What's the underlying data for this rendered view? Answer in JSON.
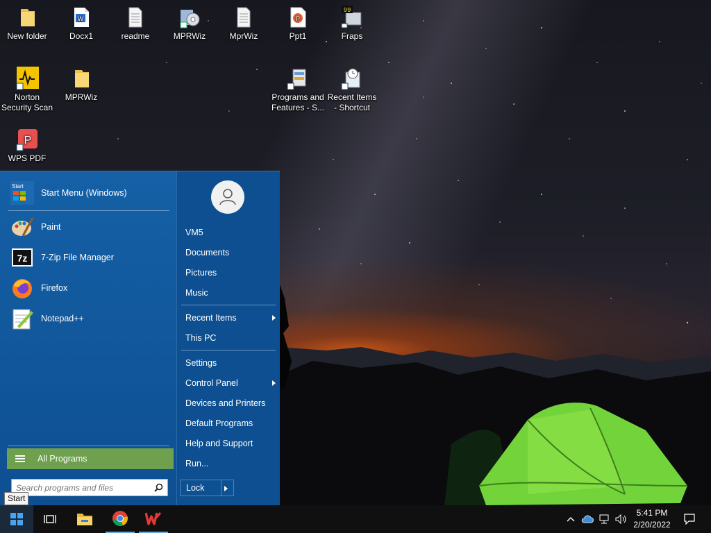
{
  "desktop": {
    "icons": [
      {
        "label": "New folder",
        "icon": "folder-icon"
      },
      {
        "label": "Docx1",
        "icon": "word-doc-icon"
      },
      {
        "label": "readme",
        "icon": "text-file-icon"
      },
      {
        "label": "MPRWiz",
        "icon": "mprwiz-installer-icon"
      },
      {
        "label": "MprWiz",
        "icon": "text-file-icon"
      },
      {
        "label": "Ppt1",
        "icon": "powerpoint-icon"
      },
      {
        "label": "Fraps",
        "icon": "fraps-icon"
      },
      {
        "label": "Norton Security Scan",
        "icon": "norton-icon"
      },
      {
        "label": "MPRWiz",
        "icon": "folder-icon"
      },
      {
        "label": "Programs and Features - S...",
        "icon": "programs-features-icon"
      },
      {
        "label": "Recent Items - Shortcut",
        "icon": "recent-items-icon"
      },
      {
        "label": "WPS PDF",
        "icon": "wps-pdf-icon"
      }
    ]
  },
  "start_menu": {
    "pinned": [
      {
        "label": "Start Menu (Windows)",
        "icon": "start-menu-icon"
      },
      {
        "label": "Paint",
        "icon": "paint-icon"
      },
      {
        "label": "7-Zip File Manager",
        "icon": "7zip-icon"
      },
      {
        "label": "Firefox",
        "icon": "firefox-icon"
      },
      {
        "label": "Notepad++",
        "icon": "notepadpp-icon"
      }
    ],
    "all_programs": "All Programs",
    "search_placeholder": "Search programs and files",
    "right_items": {
      "user": "VM5",
      "documents": "Documents",
      "pictures": "Pictures",
      "music": "Music",
      "recent": "Recent Items",
      "this_pc": "This PC",
      "settings": "Settings",
      "control_panel": "Control Panel",
      "devices": "Devices and Printers",
      "default_programs": "Default Programs",
      "help": "Help and Support",
      "run": "Run..."
    },
    "lock": "Lock"
  },
  "tooltip": "Start",
  "taskbar": {
    "time": "5:41 PM",
    "date": "2/20/2022"
  }
}
